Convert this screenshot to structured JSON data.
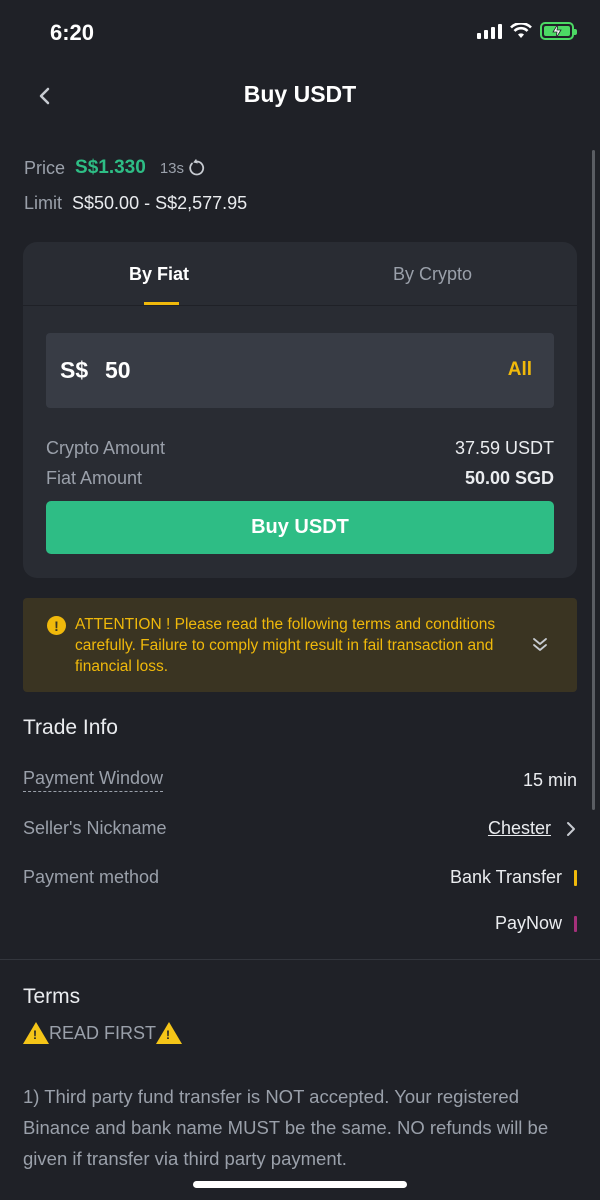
{
  "status": {
    "time": "6:20",
    "signal_icon": "cellular-signal-icon",
    "wifi_icon": "wifi-icon",
    "battery_icon": "battery-charging-icon"
  },
  "header": {
    "title": "Buy USDT",
    "back_icon": "chevron-left-icon"
  },
  "price": {
    "label": "Price",
    "value": "S$1.330",
    "timer": "13s",
    "refresh_icon": "refresh-icon"
  },
  "limit": {
    "label": "Limit",
    "value": "S$50.00 - S$2,577.95"
  },
  "tabs": [
    {
      "label": "By Fiat",
      "active": true
    },
    {
      "label": "By Crypto",
      "active": false
    }
  ],
  "amount_input": {
    "prefix": "S$",
    "value": "50",
    "all_label": "All"
  },
  "summary": {
    "crypto_label": "Crypto Amount",
    "crypto_value": "37.59 USDT",
    "fiat_label": "Fiat Amount",
    "fiat_value": "50.00 SGD"
  },
  "buy_button": {
    "label": "Buy USDT"
  },
  "attention": {
    "icon": "exclamation-circle-icon",
    "text": "ATTENTION ! Please read the following terms and conditions carefully. Failure to comply might result in fail transaction and financial loss.",
    "expand_icon": "double-chevron-down-icon"
  },
  "trade_info": {
    "title": "Trade Info",
    "payment_window_label": "Payment Window",
    "payment_window_value": "15 min",
    "seller_label": "Seller's Nickname",
    "seller_value": "Chester",
    "payment_method_label": "Payment method",
    "methods": [
      {
        "name": "Bank Transfer",
        "color": "#f0b90b"
      },
      {
        "name": "PayNow",
        "color": "#a4307a"
      }
    ]
  },
  "terms": {
    "title": "Terms",
    "read_first": "READ FIRST",
    "warning_icon": "warning-icon",
    "paragraph": "1) Third party fund transfer is NOT accepted. Your registered Binance and bank name MUST be the same. NO refunds will be given if transfer via third party payment."
  },
  "colors": {
    "background": "#1f2127",
    "card": "#292c33",
    "accent": "#f0b90b",
    "buy_green": "#2ebd85"
  }
}
